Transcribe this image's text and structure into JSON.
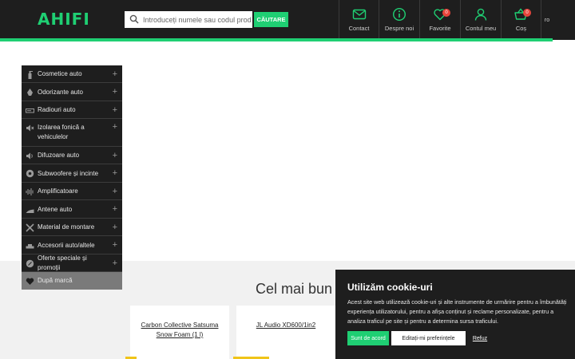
{
  "header": {
    "logo": "AHIFI",
    "search": {
      "placeholder": "Introduceți numele sau codul produsului pe care îl căutați",
      "button_label": "CĂUTARE"
    },
    "nav": {
      "contact": "Contact",
      "about": "Despre noi",
      "favorites": "Favorite",
      "favorites_count": "0",
      "account": "Contul meu",
      "cart": "Coș",
      "cart_count": "0"
    },
    "language": "ro"
  },
  "sidebar": {
    "items": [
      {
        "label": "Cosmetice auto",
        "icon": "spray-bottle-icon"
      },
      {
        "label": "Odorizante auto",
        "icon": "air-freshener-icon"
      },
      {
        "label": "Radiouri auto",
        "icon": "car-radio-icon"
      },
      {
        "label": "Izolarea fonică a vehiculelor",
        "icon": "sound-mute-icon"
      },
      {
        "label": "Difuzoare auto",
        "icon": "speaker-icon"
      },
      {
        "label": "Subwoofere și incinte",
        "icon": "subwoofer-icon"
      },
      {
        "label": "Amplificatoare",
        "icon": "amplifier-wave-icon"
      },
      {
        "label": "Antene auto",
        "icon": "antenna-icon"
      },
      {
        "label": "Material de montare",
        "icon": "tools-icon"
      },
      {
        "label": "Accesorii auto/altele",
        "icon": "car-accessory-icon"
      },
      {
        "label": "Oferte speciale și promoții",
        "icon": "percent-tag-icon"
      }
    ],
    "brand": {
      "label": "După marcă",
      "icon": "heart-icon"
    },
    "expand_symbol": "+"
  },
  "main": {
    "section_title": "Cel mai bun di",
    "products": [
      {
        "name": "Carbon Collective Satsuma Snow Foam (1 l)"
      },
      {
        "name": "JL Audio XD600/1in2"
      }
    ]
  },
  "cookie": {
    "title": "Utilizăm cookie-uri",
    "text": "Acest site web utilizează cookie-uri și alte instrumente de urmărire pentru a îmbunătăți experiența utilizatorului, pentru a afișa conținut și reclame personalizate, pentru a analiza traficul pe site și pentru a determina sursa traficului.",
    "accept": "Sunt de acord",
    "preferences": "Editați-mi preferințele",
    "refuse": "Refuz"
  },
  "colors": {
    "brand": "#1fcf73",
    "dark": "#1e1e1e",
    "badge": "#e8453c"
  }
}
